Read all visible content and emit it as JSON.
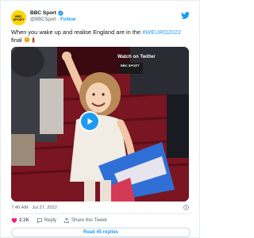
{
  "account": {
    "avatar_text": "BBC SPORT",
    "name": "BBC Sport",
    "handle": "@BBCSport",
    "separator": "·",
    "follow_label": "Follow"
  },
  "tweet": {
    "text_before": "When you wake up and realise England are in the ",
    "hashtag": "#WEURO2022",
    "text_after": " final ",
    "emoji_icons": [
      "smiling-face-icon",
      "lipstick-icon"
    ]
  },
  "media": {
    "watch_label": "Watch on Twitter",
    "badge_text": "BBC SPORT",
    "play_icon": "play-icon"
  },
  "meta": {
    "timestamp": "7:40 AM · Jul 27, 2022"
  },
  "actions": {
    "like_count": "2.1K",
    "reply_label": "Reply",
    "share_label": "Share this Tweet",
    "replies_button": "Read 45 replies"
  },
  "colors": {
    "accent": "#1d9bf0",
    "text": "#0f1419",
    "muted": "#536471",
    "like": "#f91880",
    "avatar_bg": "#ffd400"
  }
}
